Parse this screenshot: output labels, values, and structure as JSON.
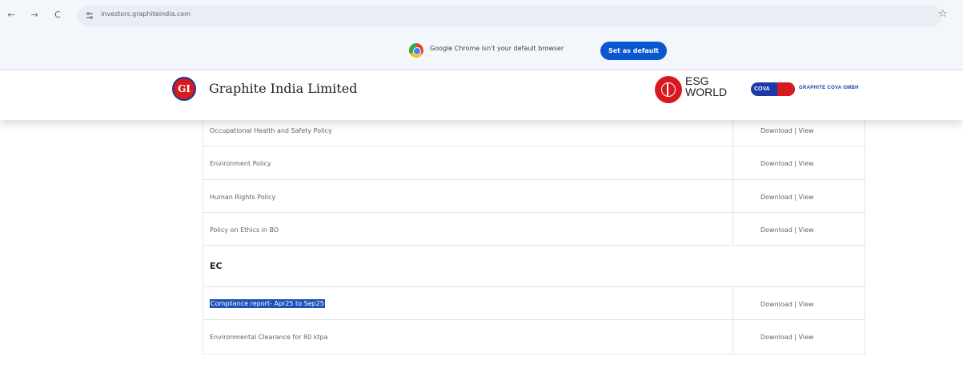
{
  "browser": {
    "url": "investors.graphiteindia.com",
    "nav": {
      "back": "←",
      "forward": "→",
      "reload": "C"
    },
    "bookmark_icon": "star-icon"
  },
  "infobar": {
    "message": "Google Chrome isn't your default browser",
    "button_label": "Set as default"
  },
  "site": {
    "logo_text": "GI",
    "company_name": "Graphite India Limited",
    "esg_line1": "ESG",
    "esg_line2": "WORLD",
    "cova_badge": "COVA",
    "cova_text": "GRAPHITE COVA GMBH"
  },
  "policies": {
    "rows": [
      {
        "name": "Occupational Health and Safety Policy",
        "actions": "Download | View"
      },
      {
        "name": "Environment Policy",
        "actions": "Download | View"
      },
      {
        "name": "Human Rights Policy",
        "actions": "Download | View"
      },
      {
        "name": "Policy on Ethics in BO",
        "actions": "Download | View"
      }
    ],
    "section_title": "EC",
    "ec_rows": [
      {
        "name": "Compliance report- Apr25 to Sep25",
        "actions": "Download | View",
        "selected": true
      },
      {
        "name": "Environmental Clearance for 80 ktpa",
        "actions": "Download | View"
      }
    ]
  }
}
